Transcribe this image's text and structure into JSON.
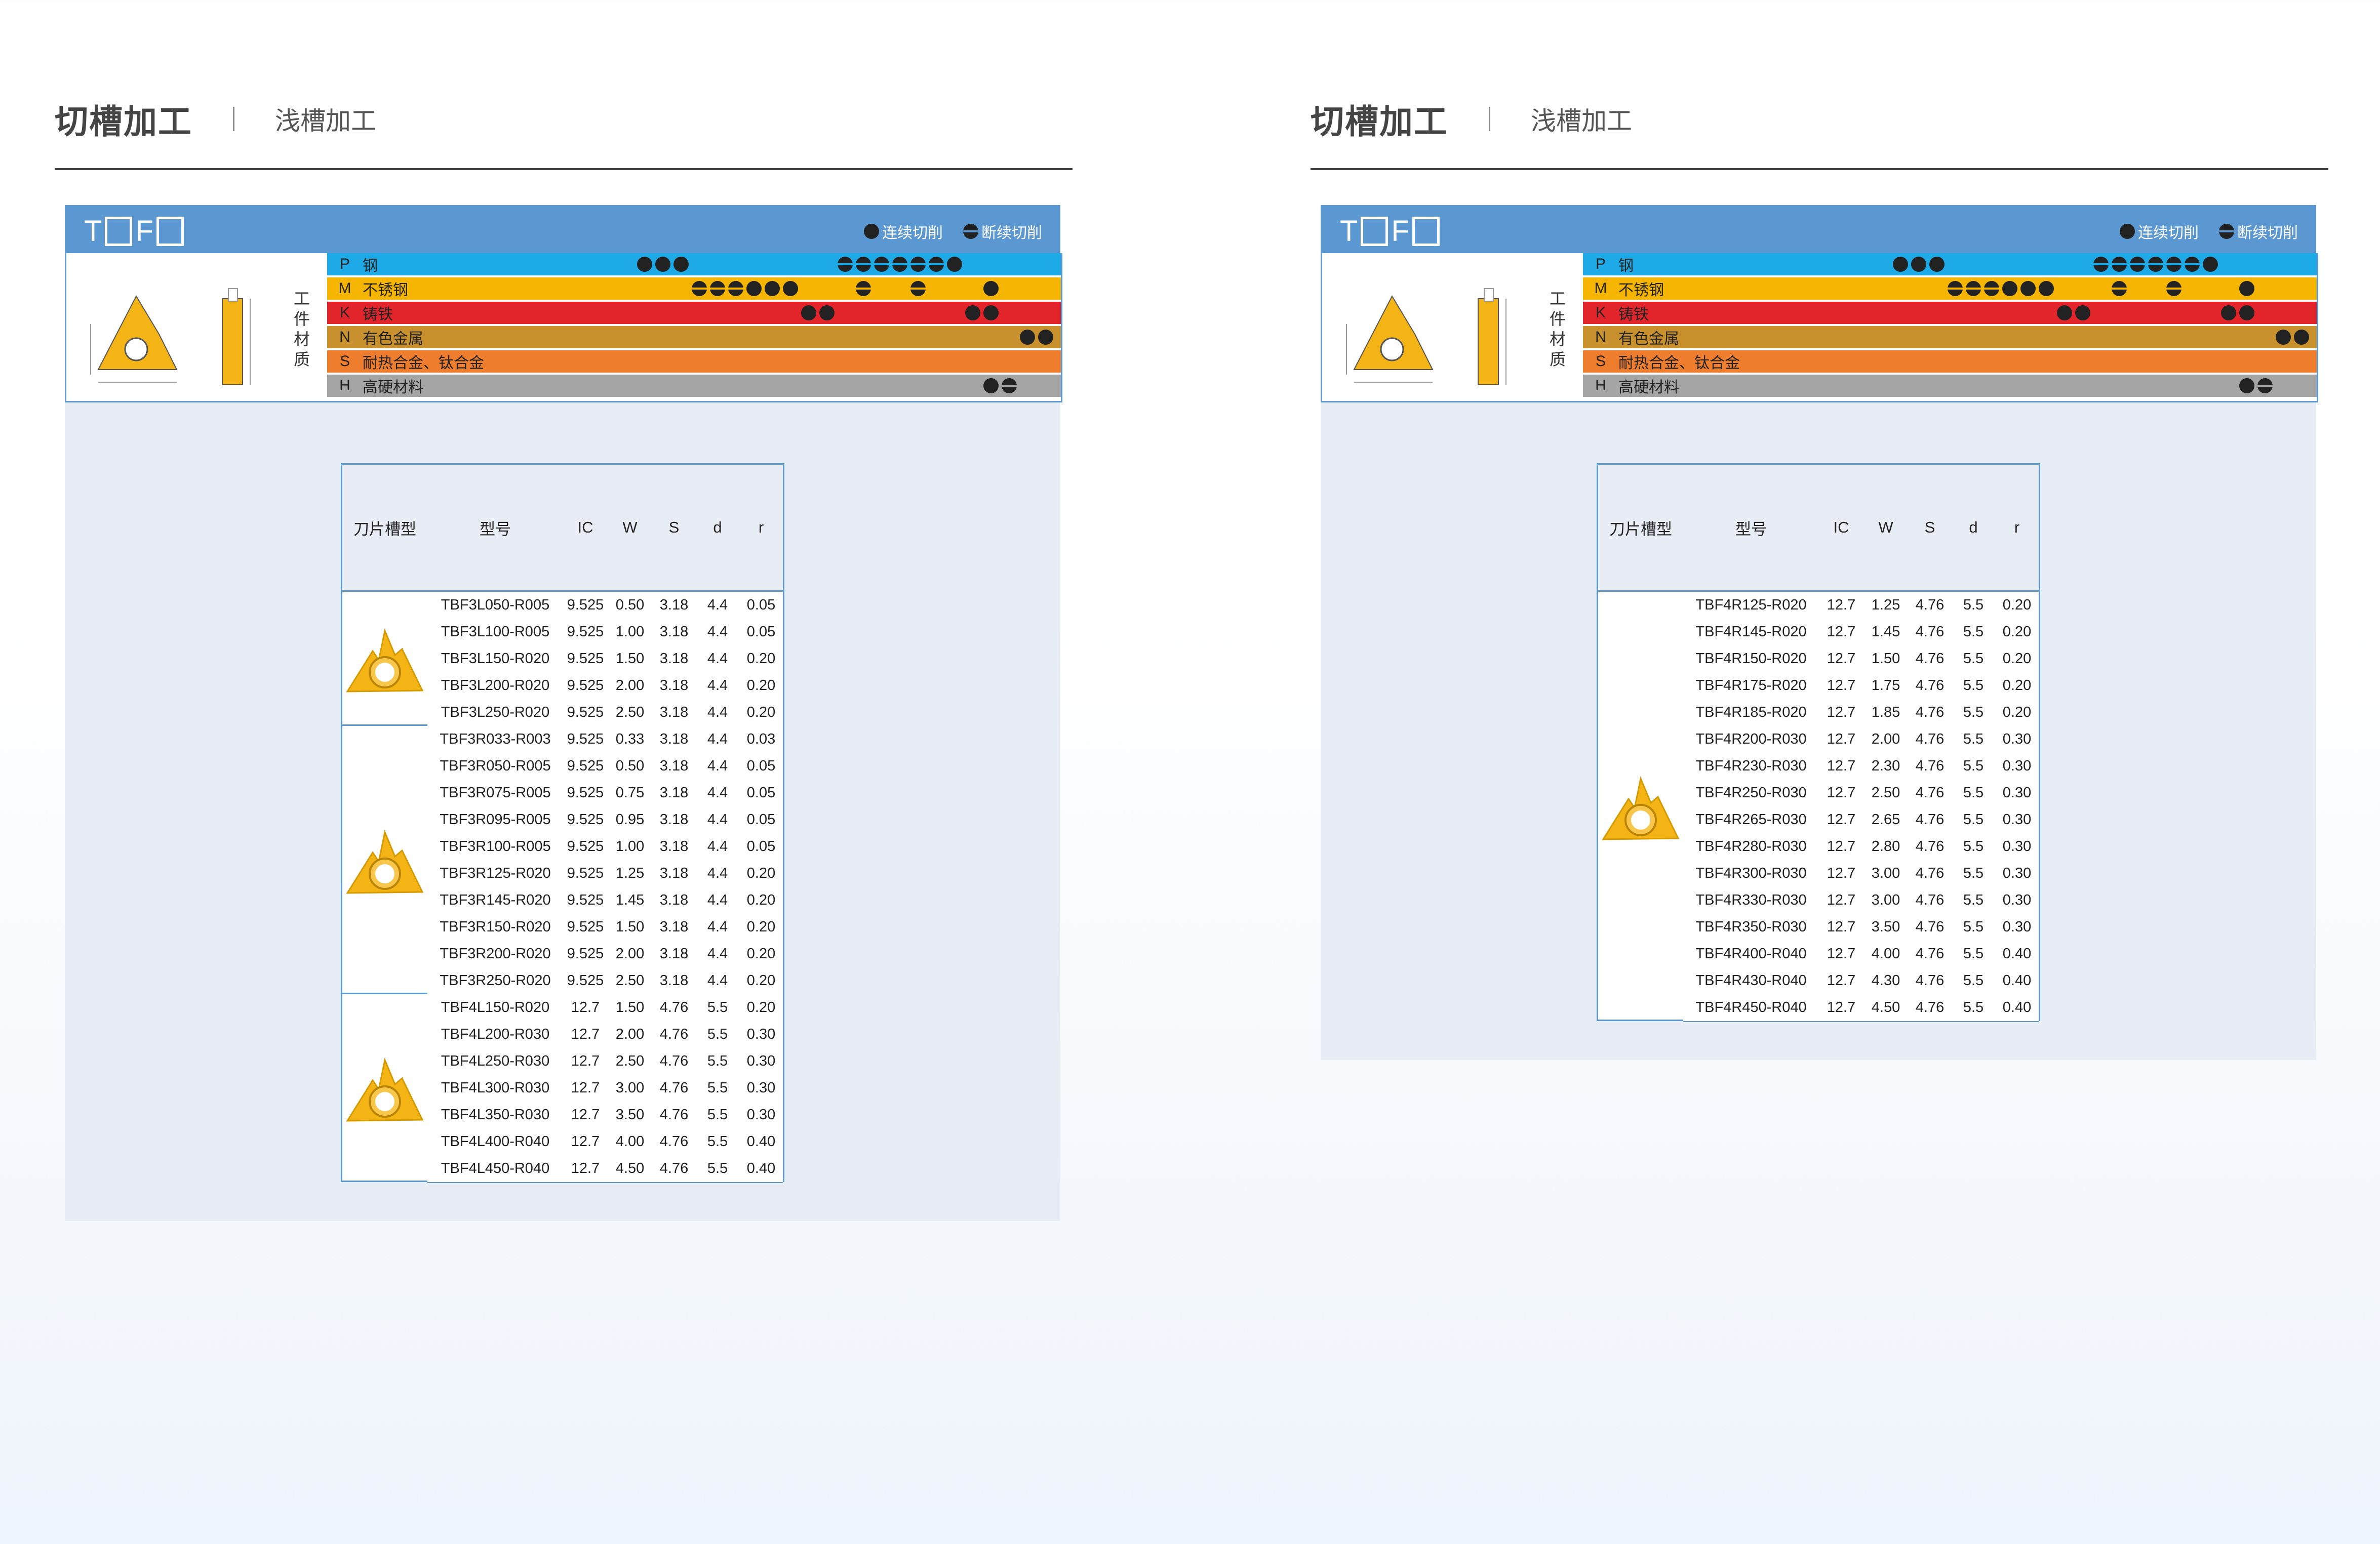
{
  "pages": [
    {
      "header": {
        "main": "切槽加工",
        "sub": "浅槽加工"
      },
      "series_prefix": [
        "T",
        "F"
      ],
      "legend": {
        "continuous": "连续切削",
        "interrupted": "断续切削"
      },
      "work_material_label": "工件材质",
      "table_headers": {
        "insert_type": "刀片槽型",
        "model": "型号",
        "ic": "IC",
        "w": "W",
        "s": "S",
        "d": "d",
        "r": "r"
      },
      "groups": [
        {
          "rows": [
            {
              "model": "TBF3L050-R005",
              "ic": "9.525",
              "w": "0.50",
              "s": "3.18",
              "d": "4.4",
              "r": "0.05"
            },
            {
              "model": "TBF3L100-R005",
              "ic": "9.525",
              "w": "1.00",
              "s": "3.18",
              "d": "4.4",
              "r": "0.05"
            },
            {
              "model": "TBF3L150-R020",
              "ic": "9.525",
              "w": "1.50",
              "s": "3.18",
              "d": "4.4",
              "r": "0.20"
            },
            {
              "model": "TBF3L200-R020",
              "ic": "9.525",
              "w": "2.00",
              "s": "3.18",
              "d": "4.4",
              "r": "0.20"
            },
            {
              "model": "TBF3L250-R020",
              "ic": "9.525",
              "w": "2.50",
              "s": "3.18",
              "d": "4.4",
              "r": "0.20"
            }
          ]
        },
        {
          "rows": [
            {
              "model": "TBF3R033-R003",
              "ic": "9.525",
              "w": "0.33",
              "s": "3.18",
              "d": "4.4",
              "r": "0.03"
            },
            {
              "model": "TBF3R050-R005",
              "ic": "9.525",
              "w": "0.50",
              "s": "3.18",
              "d": "4.4",
              "r": "0.05"
            },
            {
              "model": "TBF3R075-R005",
              "ic": "9.525",
              "w": "0.75",
              "s": "3.18",
              "d": "4.4",
              "r": "0.05"
            },
            {
              "model": "TBF3R095-R005",
              "ic": "9.525",
              "w": "0.95",
              "s": "3.18",
              "d": "4.4",
              "r": "0.05"
            },
            {
              "model": "TBF3R100-R005",
              "ic": "9.525",
              "w": "1.00",
              "s": "3.18",
              "d": "4.4",
              "r": "0.05"
            },
            {
              "model": "TBF3R125-R020",
              "ic": "9.525",
              "w": "1.25",
              "s": "3.18",
              "d": "4.4",
              "r": "0.20"
            },
            {
              "model": "TBF3R145-R020",
              "ic": "9.525",
              "w": "1.45",
              "s": "3.18",
              "d": "4.4",
              "r": "0.20"
            },
            {
              "model": "TBF3R150-R020",
              "ic": "9.525",
              "w": "1.50",
              "s": "3.18",
              "d": "4.4",
              "r": "0.20"
            },
            {
              "model": "TBF3R200-R020",
              "ic": "9.525",
              "w": "2.00",
              "s": "3.18",
              "d": "4.4",
              "r": "0.20"
            },
            {
              "model": "TBF3R250-R020",
              "ic": "9.525",
              "w": "2.50",
              "s": "3.18",
              "d": "4.4",
              "r": "0.20"
            }
          ]
        },
        {
          "rows": [
            {
              "model": "TBF4L150-R020",
              "ic": "12.7",
              "w": "1.50",
              "s": "4.76",
              "d": "5.5",
              "r": "0.20"
            },
            {
              "model": "TBF4L200-R030",
              "ic": "12.7",
              "w": "2.00",
              "s": "4.76",
              "d": "5.5",
              "r": "0.30"
            },
            {
              "model": "TBF4L250-R030",
              "ic": "12.7",
              "w": "2.50",
              "s": "4.76",
              "d": "5.5",
              "r": "0.30"
            },
            {
              "model": "TBF4L300-R030",
              "ic": "12.7",
              "w": "3.00",
              "s": "4.76",
              "d": "5.5",
              "r": "0.30"
            },
            {
              "model": "TBF4L350-R030",
              "ic": "12.7",
              "w": "3.50",
              "s": "4.76",
              "d": "5.5",
              "r": "0.30"
            },
            {
              "model": "TBF4L400-R040",
              "ic": "12.7",
              "w": "4.00",
              "s": "4.76",
              "d": "5.5",
              "r": "0.40"
            },
            {
              "model": "TBF4L450-R040",
              "ic": "12.7",
              "w": "4.50",
              "s": "4.76",
              "d": "5.5",
              "r": "0.40"
            }
          ]
        }
      ]
    },
    {
      "header": {
        "main": "切槽加工",
        "sub": "浅槽加工"
      },
      "series_prefix": [
        "T",
        "F"
      ],
      "legend": {
        "continuous": "连续切削",
        "interrupted": "断续切削"
      },
      "work_material_label": "工件材质",
      "table_headers": {
        "insert_type": "刀片槽型",
        "model": "型号",
        "ic": "IC",
        "w": "W",
        "s": "S",
        "d": "d",
        "r": "r"
      },
      "groups": [
        {
          "rows": [
            {
              "model": "TBF4R125-R020",
              "ic": "12.7",
              "w": "1.25",
              "s": "4.76",
              "d": "5.5",
              "r": "0.20"
            },
            {
              "model": "TBF4R145-R020",
              "ic": "12.7",
              "w": "1.45",
              "s": "4.76",
              "d": "5.5",
              "r": "0.20"
            },
            {
              "model": "TBF4R150-R020",
              "ic": "12.7",
              "w": "1.50",
              "s": "4.76",
              "d": "5.5",
              "r": "0.20"
            },
            {
              "model": "TBF4R175-R020",
              "ic": "12.7",
              "w": "1.75",
              "s": "4.76",
              "d": "5.5",
              "r": "0.20"
            },
            {
              "model": "TBF4R185-R020",
              "ic": "12.7",
              "w": "1.85",
              "s": "4.76",
              "d": "5.5",
              "r": "0.20"
            },
            {
              "model": "TBF4R200-R030",
              "ic": "12.7",
              "w": "2.00",
              "s": "4.76",
              "d": "5.5",
              "r": "0.30"
            },
            {
              "model": "TBF4R230-R030",
              "ic": "12.7",
              "w": "2.30",
              "s": "4.76",
              "d": "5.5",
              "r": "0.30"
            },
            {
              "model": "TBF4R250-R030",
              "ic": "12.7",
              "w": "2.50",
              "s": "4.76",
              "d": "5.5",
              "r": "0.30"
            },
            {
              "model": "TBF4R265-R030",
              "ic": "12.7",
              "w": "2.65",
              "s": "4.76",
              "d": "5.5",
              "r": "0.30"
            },
            {
              "model": "TBF4R280-R030",
              "ic": "12.7",
              "w": "2.80",
              "s": "4.76",
              "d": "5.5",
              "r": "0.30"
            },
            {
              "model": "TBF4R300-R030",
              "ic": "12.7",
              "w": "3.00",
              "s": "4.76",
              "d": "5.5",
              "r": "0.30"
            },
            {
              "model": "TBF4R330-R030",
              "ic": "12.7",
              "w": "3.00",
              "s": "4.76",
              "d": "5.5",
              "r": "0.30"
            },
            {
              "model": "TBF4R350-R030",
              "ic": "12.7",
              "w": "3.50",
              "s": "4.76",
              "d": "5.5",
              "r": "0.30"
            },
            {
              "model": "TBF4R400-R040",
              "ic": "12.7",
              "w": "4.00",
              "s": "4.76",
              "d": "5.5",
              "r": "0.40"
            },
            {
              "model": "TBF4R430-R040",
              "ic": "12.7",
              "w": "4.30",
              "s": "4.76",
              "d": "5.5",
              "r": "0.40"
            },
            {
              "model": "TBF4R450-R040",
              "ic": "12.7",
              "w": "4.50",
              "s": "4.76",
              "d": "5.5",
              "r": "0.40"
            }
          ]
        }
      ]
    }
  ],
  "materials": [
    {
      "code": "P",
      "name": "钢",
      "color": "#1eaae6",
      "symbols": [
        {
          "t": "c",
          "col": 7
        },
        {
          "t": "c",
          "col": 8
        },
        {
          "t": "c",
          "col": 9
        },
        {
          "t": "h",
          "col": 18
        },
        {
          "t": "h",
          "col": 19
        },
        {
          "t": "h",
          "col": 20
        },
        {
          "t": "h",
          "col": 21
        },
        {
          "t": "h",
          "col": 22
        },
        {
          "t": "h",
          "col": 23
        },
        {
          "t": "c",
          "col": 24
        }
      ]
    },
    {
      "code": "M",
      "name": "不锈钢",
      "color": "#f6b500",
      "symbols": [
        {
          "t": "h",
          "col": 10
        },
        {
          "t": "h",
          "col": 11
        },
        {
          "t": "h",
          "col": 12
        },
        {
          "t": "c",
          "col": 13
        },
        {
          "t": "c",
          "col": 14
        },
        {
          "t": "c",
          "col": 15
        },
        {
          "t": "h",
          "col": 19
        },
        {
          "t": "h",
          "col": 22
        },
        {
          "t": "c",
          "col": 26
        }
      ]
    },
    {
      "code": "K",
      "name": "铸铁",
      "color": "#e2242b",
      "symbols": [
        {
          "t": "c",
          "col": 16
        },
        {
          "t": "c",
          "col": 17
        },
        {
          "t": "c",
          "col": 25
        },
        {
          "t": "c",
          "col": 26
        }
      ]
    },
    {
      "code": "N",
      "name": "有色金属",
      "color": "#c8912e",
      "symbols": [
        {
          "t": "c",
          "col": 28
        },
        {
          "t": "c",
          "col": 29
        }
      ]
    },
    {
      "code": "S",
      "name": "耐热合金、钛合金",
      "color": "#ee7e2e",
      "symbols": []
    },
    {
      "code": "H",
      "name": "高硬材料",
      "color": "#a5a5a5",
      "symbols": [
        {
          "t": "c",
          "col": 26
        },
        {
          "t": "h",
          "col": 27
        }
      ]
    }
  ],
  "colors": {
    "accent": "#5b97d1",
    "insert": "#f5b416",
    "panel": "#e8edf5"
  }
}
